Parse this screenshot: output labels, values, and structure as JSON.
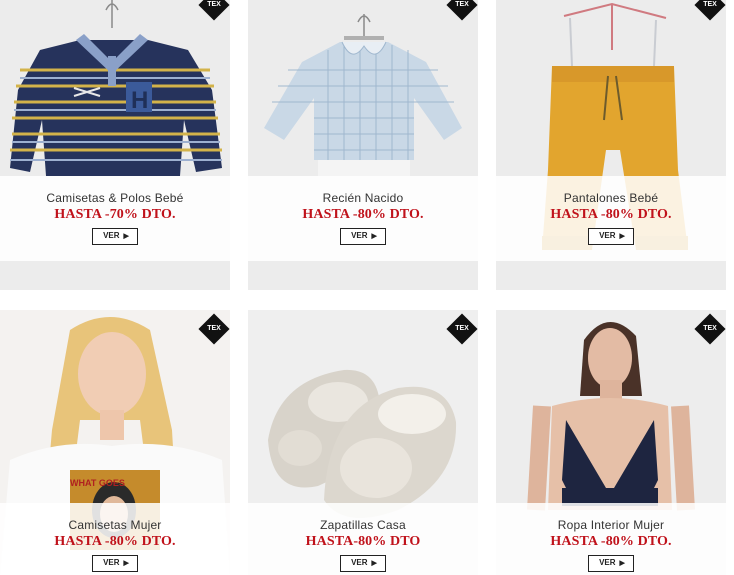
{
  "products": [
    {
      "category": "Camisetas & Polos Bebé",
      "promo": "HASTA -70% DTO.",
      "button": "VER",
      "badge": "TEX"
    },
    {
      "category": "Recién Nacido",
      "promo": "HASTA -80% DTO.",
      "button": "VER",
      "badge": "TEX"
    },
    {
      "category": "Pantalones Bebé",
      "promo": "HASTA -80% DTO.",
      "button": "VER",
      "badge": "TEX"
    },
    {
      "category": "Camisetas Mujer",
      "promo": "HASTA -80% DTO.",
      "button": "VER",
      "badge": "TEX"
    },
    {
      "category": "Zapatillas Casa",
      "promo": "HASTA-80% DTO",
      "button": "VER",
      "badge": "TEX"
    },
    {
      "category": "Ropa Interior Mujer",
      "promo": "HASTA -80% DTO.",
      "button": "VER",
      "badge": "TEX"
    }
  ],
  "colors": {
    "promo": "#c0121b",
    "card_bg": "#ececec",
    "badge": "#111111"
  }
}
